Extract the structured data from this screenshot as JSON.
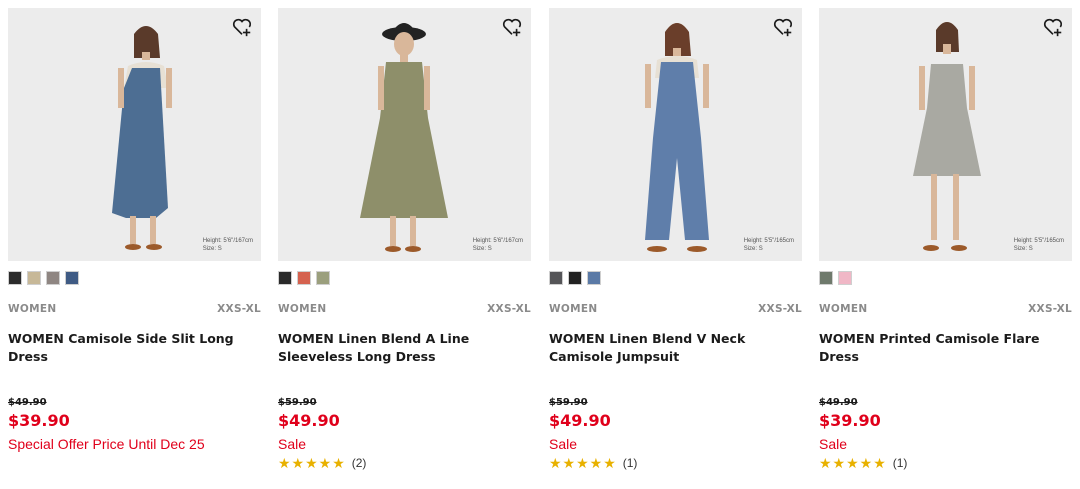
{
  "products": [
    {
      "gender": "WOMEN",
      "size_range": "XXS-XL",
      "name": "WOMEN Camisole Side Slit Long Dress",
      "original_price": "$49.90",
      "price": "$39.90",
      "flag": "Special Offer Price Until Dec 25",
      "rating_count": "",
      "stars": "",
      "height_note": [
        "Height: 5'6\"/167cm",
        "Size: S"
      ],
      "swatches": [
        "#2b2b2b",
        "#c7b898",
        "#8f8682",
        "#3f5b84"
      ],
      "dress_color": "#4d6e93",
      "favorite_icon": "heart-plus-icon"
    },
    {
      "gender": "WOMEN",
      "size_range": "XXS-XL",
      "name": "WOMEN Linen Blend A Line Sleeveless Long Dress",
      "original_price": "$59.90",
      "price": "$49.90",
      "flag": "Sale",
      "rating_count": "(2)",
      "stars": "★★★★★",
      "height_note": [
        "Height: 5'6\"/167cm",
        "Size: S"
      ],
      "swatches": [
        "#2a2a2a",
        "#d5624f",
        "#9b9f7d"
      ],
      "dress_color": "#8e8f6a",
      "favorite_icon": "heart-plus-icon"
    },
    {
      "gender": "WOMEN",
      "size_range": "XXS-XL",
      "name": "WOMEN Linen Blend V Neck Camisole Jumpsuit",
      "original_price": "$59.90",
      "price": "$49.90",
      "flag": "Sale",
      "rating_count": "(1)",
      "stars": "★★★★★",
      "height_note": [
        "Height: 5'5\"/165cm",
        "Size: S"
      ],
      "swatches": [
        "#555558",
        "#222222",
        "#5b7aa6"
      ],
      "dress_color": "#5f7eaa",
      "favorite_icon": "heart-plus-icon"
    },
    {
      "gender": "WOMEN",
      "size_range": "XXS-XL",
      "name": "WOMEN Printed Camisole Flare Dress",
      "original_price": "$49.90",
      "price": "$39.90",
      "flag": "Sale",
      "rating_count": "(1)",
      "stars": "★★★★★",
      "height_note": [
        "Height: 5'5\"/165cm",
        "Size: S"
      ],
      "swatches": [
        "#6f7a6c",
        "#f0b7c6"
      ],
      "dress_color": "#a9a9a2",
      "favorite_icon": "heart-plus-icon"
    }
  ]
}
